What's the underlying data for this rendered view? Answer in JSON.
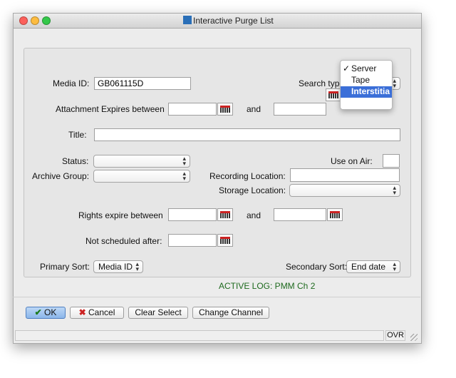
{
  "window": {
    "title": "Interactive Purge List"
  },
  "form": {
    "media_id_label": "Media ID:",
    "media_id_value": "GB061115D",
    "search_type_label": "Search type",
    "search_type_options": [
      "Server",
      "Tape",
      "Interstitia"
    ],
    "search_type_checked": "Server",
    "search_type_highlighted": "Interstitia",
    "attachment_expires_label": "Attachment Expires between",
    "and_label": "and",
    "title_label": "Title:",
    "status_label": "Status:",
    "use_on_air_label": "Use on Air:",
    "archive_group_label": "Archive Group:",
    "recording_location_label": "Recording Location:",
    "storage_location_label": "Storage Location:",
    "rights_expire_label": "Rights expire between",
    "not_scheduled_label": "Not scheduled after:",
    "primary_sort_label": "Primary Sort:",
    "primary_sort_value": "Media ID",
    "secondary_sort_label": "Secondary Sort:",
    "secondary_sort_value": "End date"
  },
  "active_log": "ACTIVE LOG: PMM Ch 2",
  "buttons": {
    "ok": "OK",
    "cancel": "Cancel",
    "clear_select": "Clear Select",
    "change_channel": "Change Channel"
  },
  "statusbar": {
    "ovr": "OVR"
  }
}
